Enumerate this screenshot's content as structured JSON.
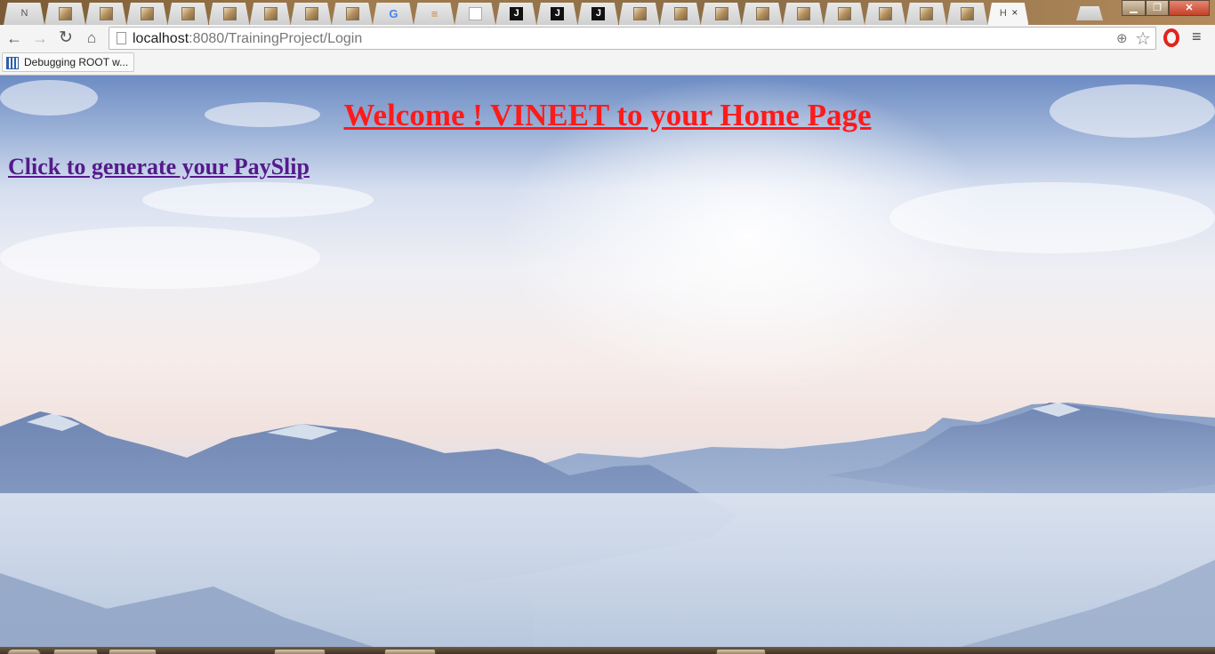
{
  "tabs": [
    {
      "favicon": "text-icon",
      "label": "N"
    },
    {
      "favicon": "image-icon"
    },
    {
      "favicon": "image-icon"
    },
    {
      "favicon": "image-icon"
    },
    {
      "favicon": "image-icon"
    },
    {
      "favicon": "image-icon"
    },
    {
      "favicon": "image-icon"
    },
    {
      "favicon": "image-icon"
    },
    {
      "favicon": "image-icon"
    },
    {
      "favicon": "google-icon",
      "label": "G"
    },
    {
      "favicon": "menu-icon",
      "label": "≡"
    },
    {
      "favicon": "page-icon"
    },
    {
      "favicon": "j-icon",
      "label": "J"
    },
    {
      "favicon": "j-icon",
      "label": "J"
    },
    {
      "favicon": "j-icon",
      "label": "J"
    },
    {
      "favicon": "image-icon"
    },
    {
      "favicon": "image-icon"
    },
    {
      "favicon": "image-icon"
    },
    {
      "favicon": "image-icon"
    },
    {
      "favicon": "image-icon"
    },
    {
      "favicon": "image-icon"
    },
    {
      "favicon": "image-icon"
    },
    {
      "favicon": "image-icon"
    },
    {
      "favicon": "image-icon"
    },
    {
      "favicon": "text-icon",
      "label": "H",
      "active": true,
      "close": "×"
    }
  ],
  "window_controls": {
    "minimize": "▁",
    "maximize": "❐",
    "close": "✕"
  },
  "toolbar": {
    "back": "←",
    "forward": "→",
    "reload": "↻",
    "home": "⌂",
    "url_host": "localhost",
    "url_path": ":8080/TrainingProject/Login",
    "zoom": "⊕",
    "star": "☆",
    "menu": "≡"
  },
  "bookmarks": [
    {
      "label": "Debugging ROOT w..."
    }
  ],
  "page": {
    "title": "Welcome ! VINEET to your Home Page",
    "link": "Click to generate your PaySlip"
  },
  "colors": {
    "title": "#ff1a1a",
    "link_visited": "#551a8b",
    "opera": "#e0231c"
  }
}
